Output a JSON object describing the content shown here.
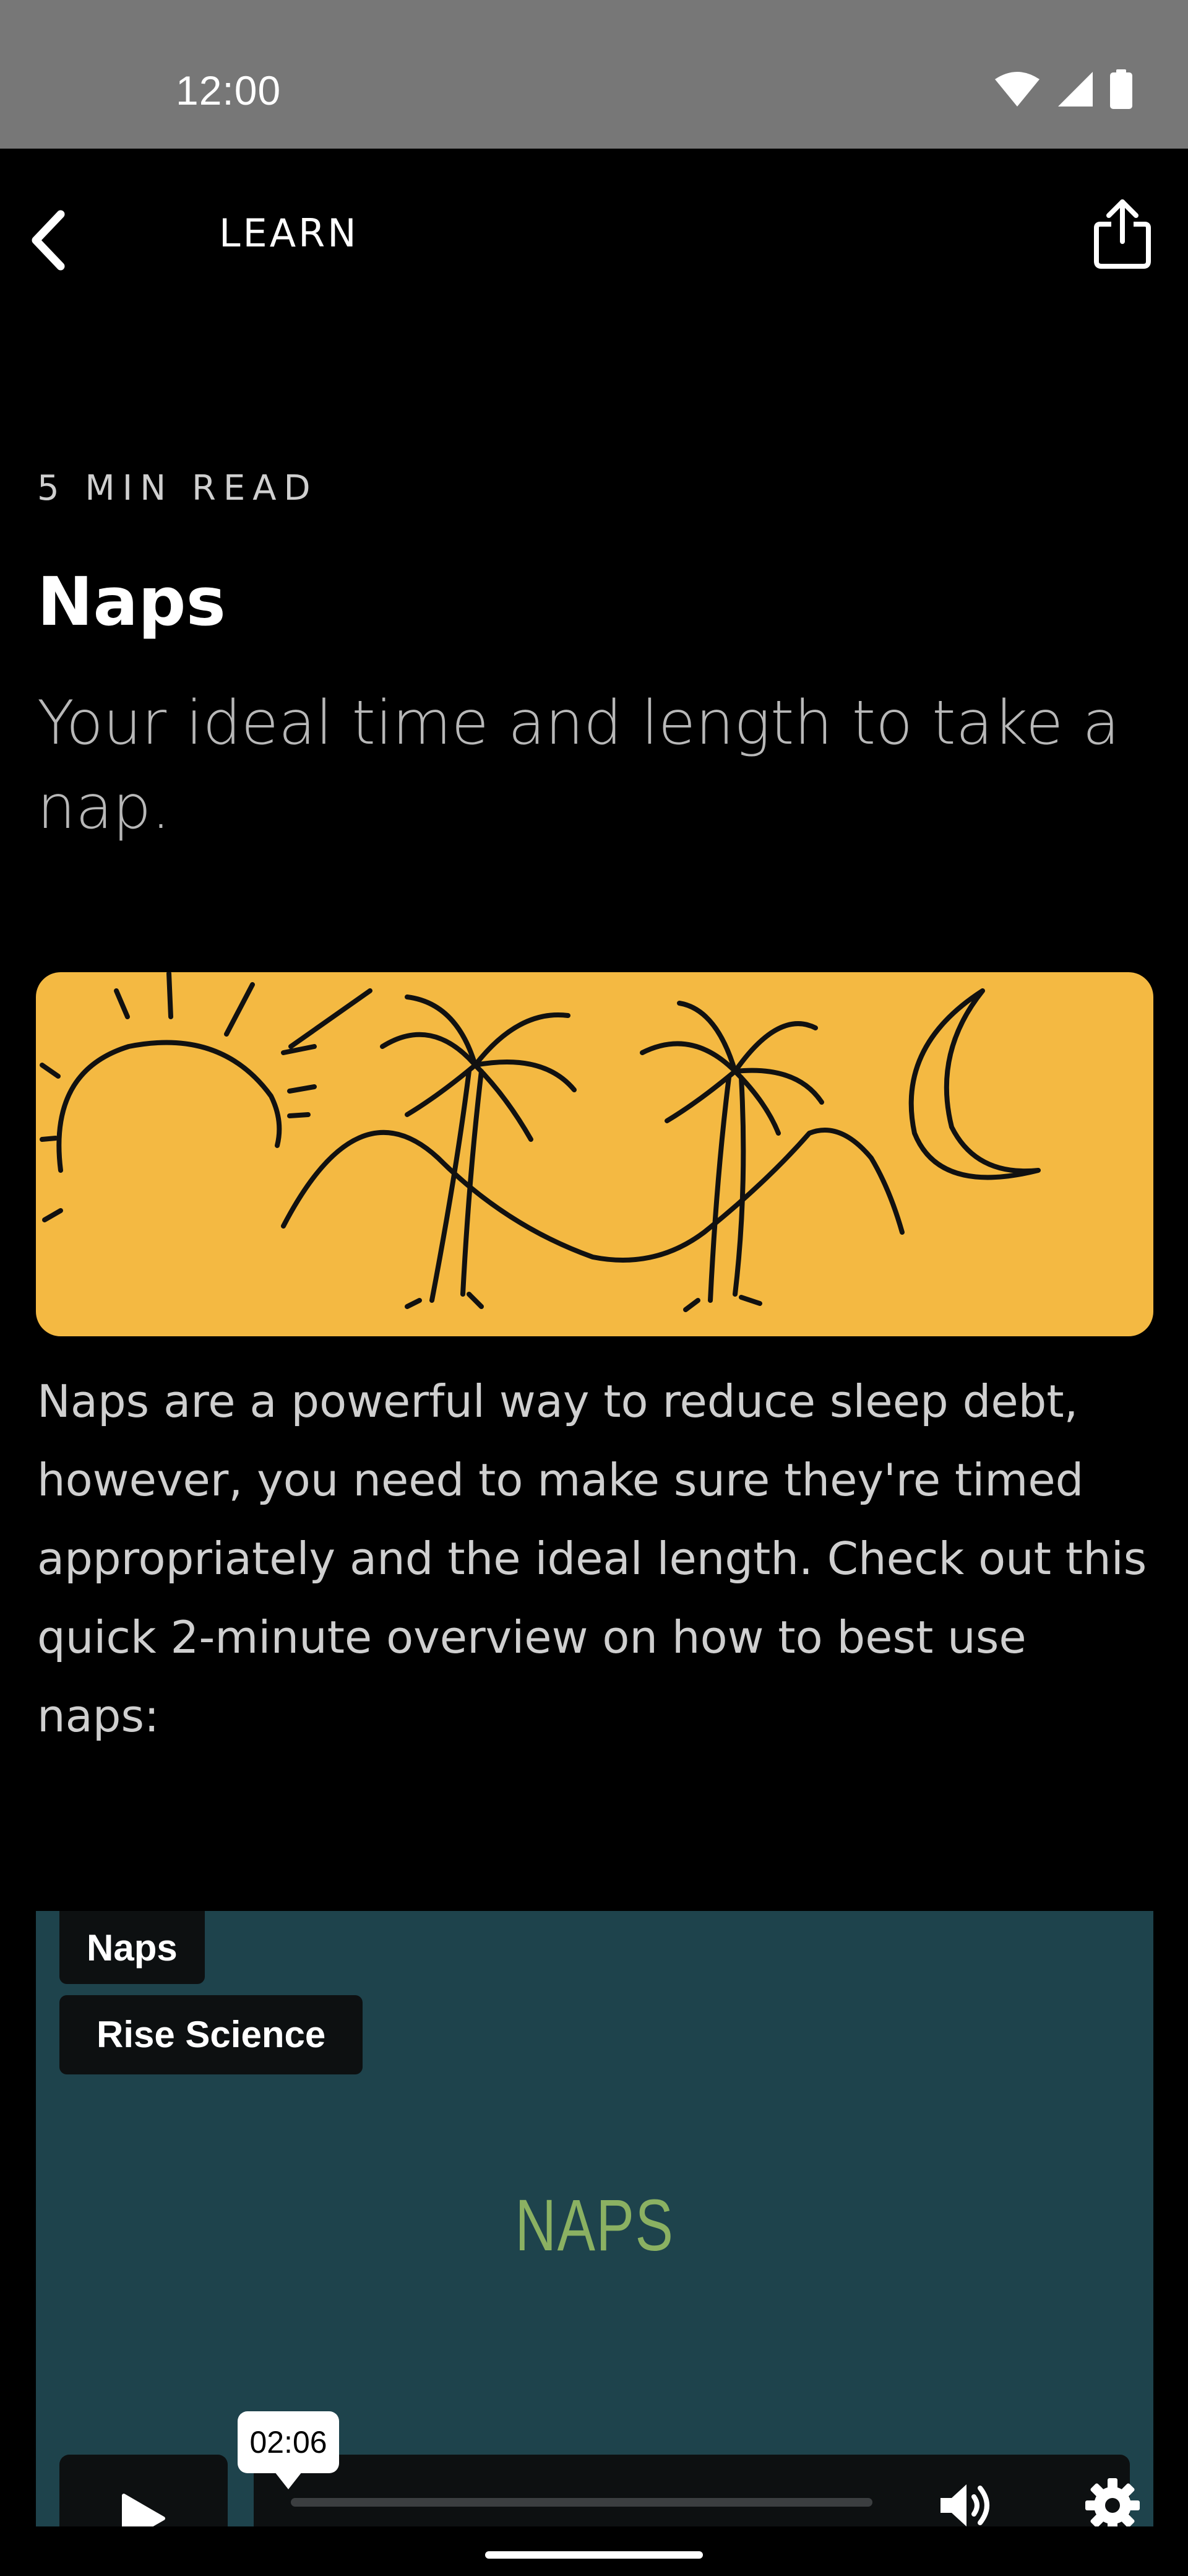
{
  "status_bar": {
    "time": "12:00",
    "icons": [
      "wifi-icon",
      "cellular-signal-icon",
      "battery-icon"
    ]
  },
  "app_bar": {
    "title": "LEARN",
    "back_icon": "chevron-left-icon",
    "share_icon": "share-icon"
  },
  "article": {
    "read_time": "5 MIN READ",
    "title": "Naps",
    "subtitle": "Your ideal time and length to take a nap.",
    "hero_image": "sun-palm-trees-moon-illustration",
    "body": "Naps are a powerful way to reduce sleep debt, however, you need to make sure they're timed appropriately and the ideal length. Check out this quick 2-minute overview on how to best use naps:"
  },
  "video": {
    "title_chip": "Naps",
    "channel_chip": "Rise Science",
    "heading": "NAPS",
    "duration_tooltip": "02:06",
    "play_icon": "play-icon",
    "volume_icon": "volume-icon",
    "settings_icon": "gear-icon",
    "progress_fraction": 0
  },
  "colors": {
    "background": "#000000",
    "status_bar": "#777777",
    "hero_background": "#F4B942",
    "video_background": "#1E434C",
    "video_heading": "#8BB162"
  }
}
